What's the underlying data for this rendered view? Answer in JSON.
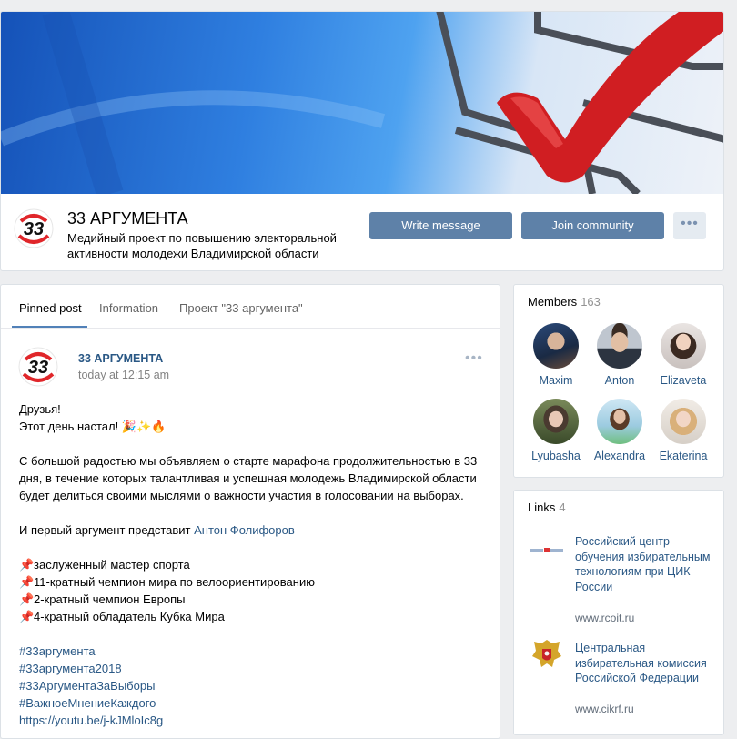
{
  "header": {
    "group_name": "33 АРГУМЕНТА",
    "description": "Медийный проект по повышению электоральной активности молодежи Владимирской области",
    "write_message": "Write message",
    "join_community": "Join community",
    "more": "•••",
    "logo_text": "33"
  },
  "tabs": {
    "pinned": "Pinned post",
    "information": "Information",
    "project": "Проект \"33 аргумента\""
  },
  "post": {
    "author": "33 АРГУМЕНТА",
    "time": "today at 12:15 am",
    "more": "•••",
    "line1": "Друзья!",
    "line2": "Этот день настал! 🎉✨🔥",
    "para1_l1": "С большой радостью мы объявляем о старте марафона продолжительностью в 33",
    "para1_l2": "дня, в течение которых талантливая и успешная молодежь Владимирской области",
    "para1_l3": "будет делиться своими мыслями о важности участия в голосовании на выборах.",
    "arg_prefix": "И первый аргумент представит ",
    "arg_person": "Антон Фолифоров",
    "bullets": [
      "заслуженный мастер спорта",
      "11-кратный чемпион мира по велоориентированию",
      "2-кратный чемпион Европы",
      "4-кратный обладатель Кубка Мира"
    ],
    "pin_glyph": "📌",
    "hashtags": [
      "#33аргумента",
      "#33аргумента2018",
      "#33АргументаЗаВыборы",
      "#ВажноеМнениеКаждого"
    ],
    "url": "https://youtu.be/j-kJMloIc8g"
  },
  "members": {
    "title": "Members",
    "count": "163",
    "list": [
      {
        "name": "Maxim"
      },
      {
        "name": "Anton"
      },
      {
        "name": "Elizaveta"
      },
      {
        "name": "Lyubasha"
      },
      {
        "name": "Alexandra"
      },
      {
        "name": "Ekaterina"
      }
    ]
  },
  "links": {
    "title": "Links",
    "count": "4",
    "items": [
      {
        "title": "Российский центр обучения избирательным технологиям при ЦИК России",
        "url": "www.rcoit.ru",
        "icon": "rcoit-logo-icon"
      },
      {
        "title": "Центральная избирательная комиссия Российской Федерации",
        "url": "www.cikrf.ru",
        "icon": "coat-of-arms-icon"
      }
    ]
  },
  "colors": {
    "accent": "#5e81a8",
    "link": "#2a5885",
    "background": "#edeef0",
    "logo_red": "#e0262a"
  }
}
